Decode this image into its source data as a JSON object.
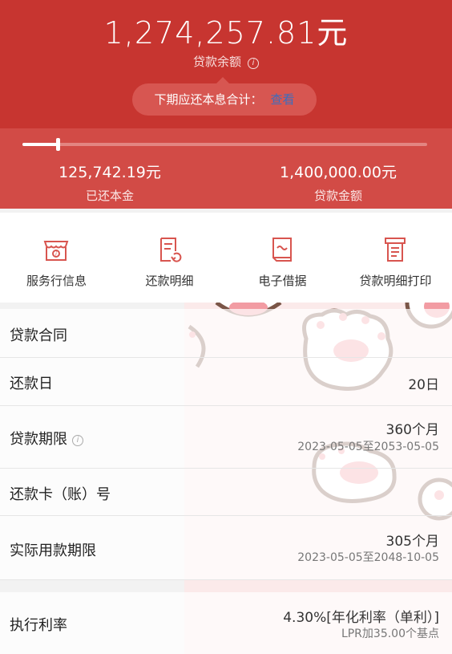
{
  "header": {
    "remaining_amount": "1,274,257.81元",
    "remaining_label": "贷款余额",
    "info_glyph": "i",
    "next_due_label": "下期应还本息合计：",
    "next_due_link": "查看"
  },
  "progress": {
    "repaid_fraction": 0.09,
    "repaid_principal_value": "125,742.19元",
    "repaid_principal_label": "已还本金",
    "loan_amount_value": "1,400,000.00元",
    "loan_amount_label": "贷款金额"
  },
  "menu": {
    "items": [
      {
        "label": "服务行信息",
        "icon": "bank-branch-icon"
      },
      {
        "label": "还款明细",
        "icon": "repayment-detail-icon"
      },
      {
        "label": "电子借据",
        "icon": "e-receipt-icon"
      },
      {
        "label": "贷款明细打印",
        "icon": "print-icon"
      }
    ]
  },
  "details": {
    "contract": {
      "label": "贷款合同"
    },
    "repay_day": {
      "label": "还款日",
      "value": "20日"
    },
    "term": {
      "label": "贷款期限",
      "value": "360个月",
      "range": "2023-05-05至2053-05-05"
    },
    "card": {
      "label": "还款卡（账）号"
    },
    "actual_term": {
      "label": "实际用款期限",
      "value": "305个月",
      "range": "2023-05-05至2048-10-05"
    },
    "rate": {
      "label": "执行利率",
      "value": "4.30%[年化利率（单利）]",
      "sub": "LPR加35.00个基点"
    }
  },
  "colors": {
    "brand_red": "#c73530",
    "band_red": "#d24b46",
    "icon_red": "#d8554f",
    "link_blue": "#3a6dbf",
    "paw_brown": "#7a5547",
    "paw_pink": "#f29ca3"
  }
}
